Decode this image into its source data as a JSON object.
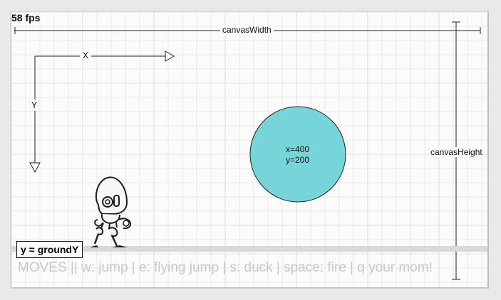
{
  "hud": {
    "fps": "58 fps",
    "canvas_width_label": "canvasWidth",
    "canvas_height_label": "canvasHeight",
    "axis_x_label": "X",
    "axis_y_label": "Y",
    "ground_label": "y = groundY",
    "moves_text": "MOVES || w: jump | e: flying jump | s: duck | space: fire | q your mom!"
  },
  "ball": {
    "x_text": "x=400",
    "y_text": "y=200",
    "color": "#77d5d9"
  },
  "colors": {
    "grid": "#d6d6d6",
    "ground": "#d9d9d9",
    "lines": "#222222",
    "frame": "#bdbdbd"
  },
  "player": {
    "sprite": "robot"
  }
}
